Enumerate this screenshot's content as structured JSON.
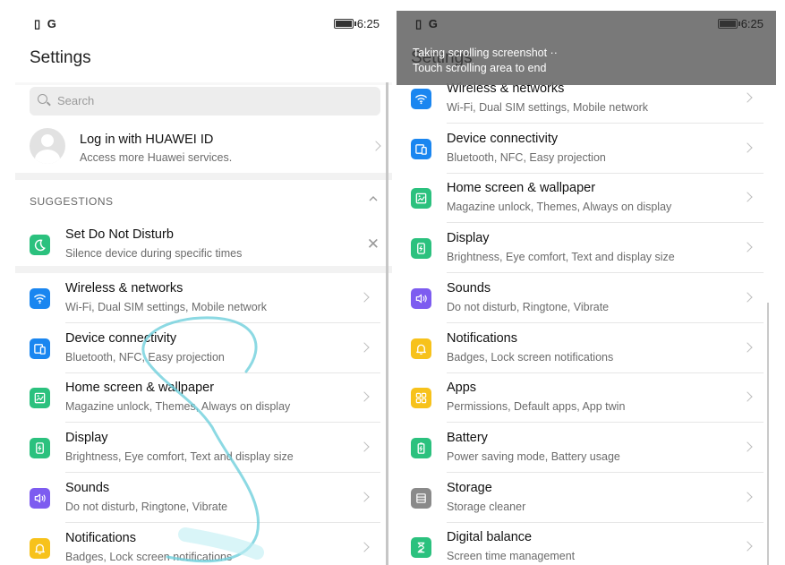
{
  "left": {
    "status": {
      "icons": "G",
      "time": "6:25"
    },
    "title": "Settings",
    "search": {
      "placeholder": "Search"
    },
    "account": {
      "title": "Log in with HUAWEI ID",
      "subtitle": "Access more Huawei services."
    },
    "suggestions": {
      "header": "SUGGESTIONS",
      "items": [
        {
          "title": "Set Do Not Disturb",
          "subtitle": "Silence device during specific times",
          "icon": "moon-icon",
          "color": "#2bc17e"
        }
      ]
    },
    "items": [
      {
        "title": "Wireless & networks",
        "subtitle": "Wi-Fi, Dual SIM settings, Mobile network",
        "icon": "wifi-icon",
        "color": "#1a86f0"
      },
      {
        "title": "Device connectivity",
        "subtitle": "Bluetooth, NFC, Easy projection",
        "icon": "devices-icon",
        "color": "#1a86f0"
      },
      {
        "title": "Home screen & wallpaper",
        "subtitle": "Magazine unlock, Themes, Always on display",
        "icon": "image-icon",
        "color": "#2bc17e"
      },
      {
        "title": "Display",
        "subtitle": "Brightness, Eye comfort, Text and display size",
        "icon": "display-icon",
        "color": "#2bc17e"
      },
      {
        "title": "Sounds",
        "subtitle": "Do not disturb, Ringtone, Vibrate",
        "icon": "sound-icon",
        "color": "#7d5cf0"
      },
      {
        "title": "Notifications",
        "subtitle": "Badges, Lock screen notifications",
        "icon": "bell-icon",
        "color": "#f7c21b"
      }
    ]
  },
  "right": {
    "status": {
      "icons": "G",
      "time": "6:25"
    },
    "title": "Settings",
    "overlay": {
      "line1": "Taking scrolling screenshot ··",
      "line2": "Touch scrolling area to end"
    },
    "items": [
      {
        "title": "Wireless & networks",
        "subtitle": "Wi-Fi, Dual SIM settings, Mobile network",
        "icon": "wifi-icon",
        "color": "#1a86f0"
      },
      {
        "title": "Device connectivity",
        "subtitle": "Bluetooth, NFC, Easy projection",
        "icon": "devices-icon",
        "color": "#1a86f0"
      },
      {
        "title": "Home screen & wallpaper",
        "subtitle": "Magazine unlock, Themes, Always on display",
        "icon": "image-icon",
        "color": "#2bc17e"
      },
      {
        "title": "Display",
        "subtitle": "Brightness, Eye comfort, Text and display size",
        "icon": "display-icon",
        "color": "#2bc17e"
      },
      {
        "title": "Sounds",
        "subtitle": "Do not disturb, Ringtone, Vibrate",
        "icon": "sound-icon",
        "color": "#7d5cf0"
      },
      {
        "title": "Notifications",
        "subtitle": "Badges, Lock screen notifications",
        "icon": "bell-icon",
        "color": "#f7c21b"
      },
      {
        "title": "Apps",
        "subtitle": "Permissions, Default apps, App twin",
        "icon": "apps-icon",
        "color": "#f7c21b"
      },
      {
        "title": "Battery",
        "subtitle": "Power saving mode, Battery usage",
        "icon": "battery-icon",
        "color": "#2bc17e"
      },
      {
        "title": "Storage",
        "subtitle": "Storage cleaner",
        "icon": "storage-icon",
        "color": "#8a8a8a"
      },
      {
        "title": "Digital balance",
        "subtitle": "Screen time management",
        "icon": "hourglass-icon",
        "color": "#2bc17e"
      }
    ]
  }
}
